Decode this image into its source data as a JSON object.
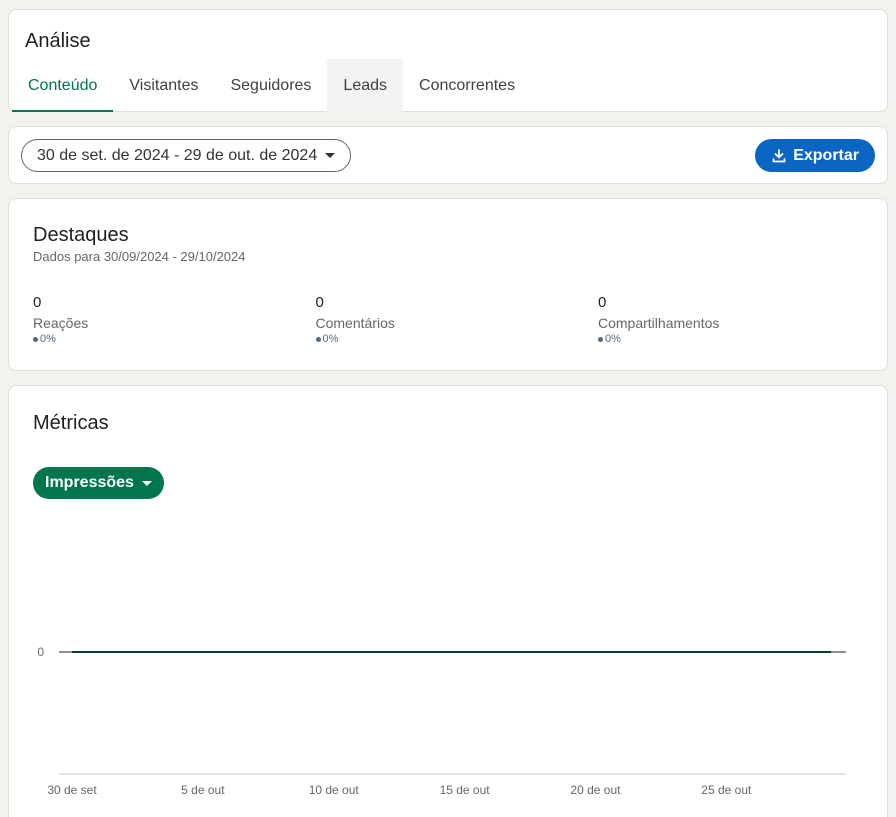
{
  "header": {
    "title": "Análise",
    "tabs": [
      {
        "label": "Conteúdo"
      },
      {
        "label": "Visitantes"
      },
      {
        "label": "Seguidores"
      },
      {
        "label": "Leads"
      },
      {
        "label": "Concorrentes"
      }
    ]
  },
  "toolbar": {
    "date_range": "30 de set. de 2024 - 29 de out. de 2024",
    "export_label": "Exportar"
  },
  "highlights": {
    "title": "Destaques",
    "subtitle": "Dados para 30/09/2024 - 29/10/2024",
    "stats": [
      {
        "value": "0",
        "label": "Reações",
        "change": "0%"
      },
      {
        "value": "0",
        "label": "Comentários",
        "change": "0%"
      },
      {
        "value": "0",
        "label": "Compartilhamentos",
        "change": "0%"
      }
    ]
  },
  "metrics": {
    "title": "Métricas",
    "selected_metric": "Impressões"
  },
  "chart_data": {
    "type": "line",
    "y_tick_labels": [
      "0"
    ],
    "x_tick_labels": [
      "30 de set",
      "5 de out",
      "10 de out",
      "15 de out",
      "20 de out",
      "25 de out"
    ],
    "series": [
      {
        "values": [
          0,
          0,
          0,
          0,
          0,
          0,
          0,
          0,
          0,
          0,
          0,
          0,
          0,
          0,
          0,
          0,
          0,
          0,
          0,
          0,
          0,
          0,
          0,
          0,
          0,
          0,
          0,
          0,
          0,
          0
        ]
      }
    ],
    "line_color": "#0b3d2e"
  },
  "colors": {
    "accent_green": "#01754f",
    "brand_blue": "#0a66c2"
  }
}
